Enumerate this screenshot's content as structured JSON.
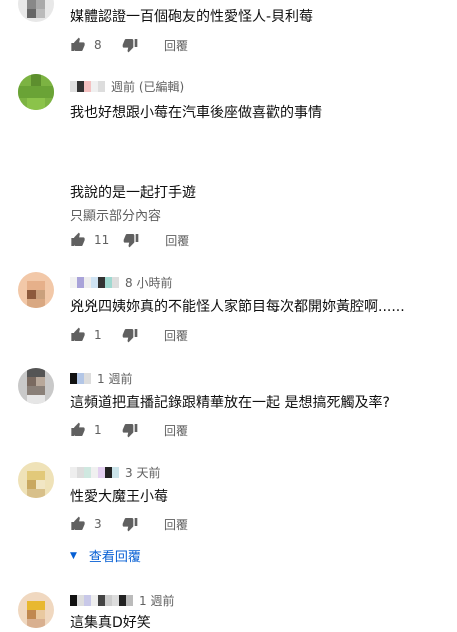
{
  "comments": [
    {
      "text": "媒體認證一百個砲友的性愛怪人-貝利莓",
      "likes": "8",
      "reply": "回覆"
    },
    {
      "time": "週前 (已編輯)",
      "text": "我也好想跟小莓在汽車後座做喜歡的事情",
      "text2": "我說的是一起打手遊",
      "show_partial": "只顯示部分內容",
      "likes": "11",
      "reply": "回覆"
    },
    {
      "time": "8 小時前",
      "text": "兇兇四姨妳真的不能怪人家節目每次都開妳黃腔啊......",
      "likes": "1",
      "reply": "回覆"
    },
    {
      "time": "1 週前",
      "text": "這頻道把直播記錄跟精華放在一起 是想搞死觸及率?",
      "likes": "1",
      "reply": "回覆"
    },
    {
      "time": "3 天前",
      "text": "性愛大魔王小莓",
      "likes": "3",
      "reply": "回覆",
      "view_replies": "查看回覆"
    },
    {
      "time": "1 週前",
      "text": "這集真D好笑"
    }
  ],
  "colors": {
    "text": "#0f0f0f",
    "secondary": "#606060",
    "link": "#065fd4"
  },
  "icons": {
    "like": "thumbs-up-icon",
    "dislike": "thumbs-down-icon",
    "expand": "chevron-down-icon"
  }
}
